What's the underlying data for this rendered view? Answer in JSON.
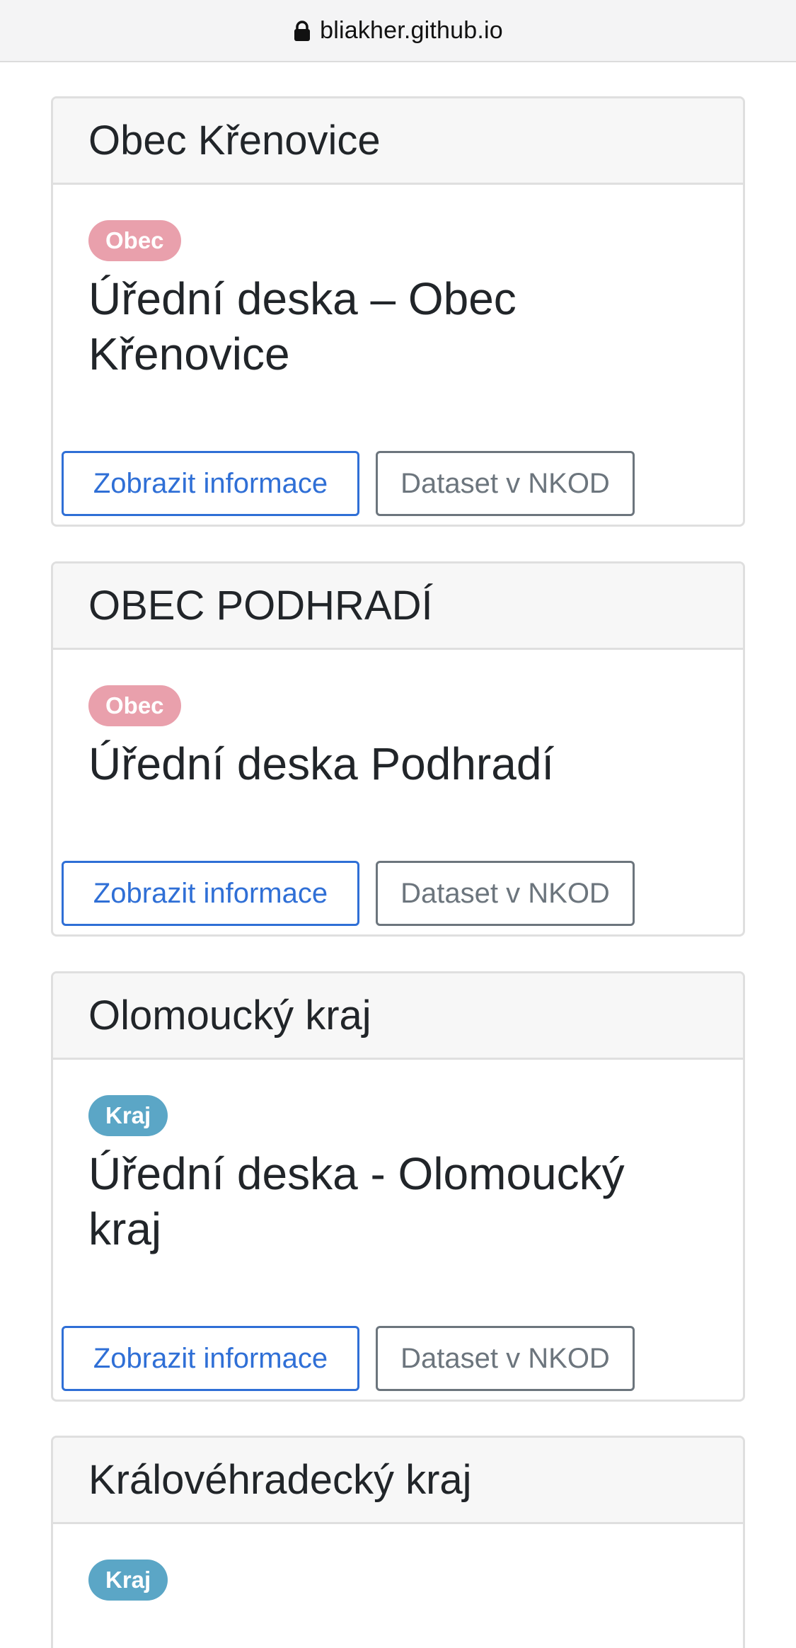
{
  "browser": {
    "url": "bliakher.github.io",
    "lock_icon": "lock-icon"
  },
  "cards": [
    {
      "header": "Obec Křenovice",
      "badge": "Obec",
      "title": "Úřední deska – Obec Křenovice",
      "info_button": "Zobrazit informace",
      "dataset_button": "Dataset v NKOD"
    },
    {
      "header": "OBEC PODHRADÍ",
      "badge": "Obec",
      "title": "Úřední deska Podhradí",
      "info_button": "Zobrazit informace",
      "dataset_button": "Dataset v NKOD"
    },
    {
      "header": "Olomoucký kraj",
      "badge": "Kraj",
      "title": "Úřední deska - Olomoucký kraj",
      "info_button": "Zobrazit informace",
      "dataset_button": "Dataset v NKOD"
    },
    {
      "header": "Královéhradecký kraj",
      "badge": "Kraj"
    }
  ],
  "colors": {
    "obec_badge": "#e9a0ac",
    "kraj_badge": "#5ba6c6",
    "info_button": "#2f6fd6",
    "dataset_button": "#6c757d"
  }
}
